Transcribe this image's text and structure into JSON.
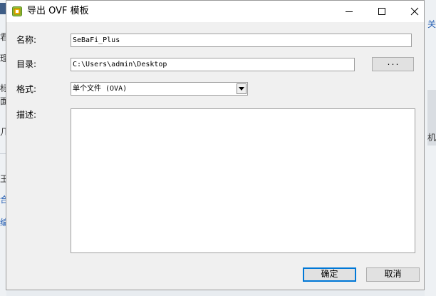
{
  "window": {
    "title": "导出 OVF 模板"
  },
  "form": {
    "name_label": "名称:",
    "name_value": "SeBaFi_Plus",
    "dir_label": "目录:",
    "dir_value": "C:\\Users\\admin\\Desktop",
    "browse_label": "...",
    "format_label": "格式:",
    "format_value": "单个文件 (OVA)",
    "desc_label": "描述:",
    "desc_value": ""
  },
  "buttons": {
    "ok": "确定",
    "cancel": "取消"
  },
  "background": {
    "left_fragments": [
      "君",
      "理",
      "标",
      "面",
      "几",
      "王",
      "合",
      "编"
    ],
    "right_fragments": [
      "关",
      "机"
    ]
  },
  "colors": {
    "link_blue": "#2a62b5",
    "accent": "#0078d7",
    "icon_green": "#8dbf3a",
    "icon_yellow": "#f5b400"
  }
}
